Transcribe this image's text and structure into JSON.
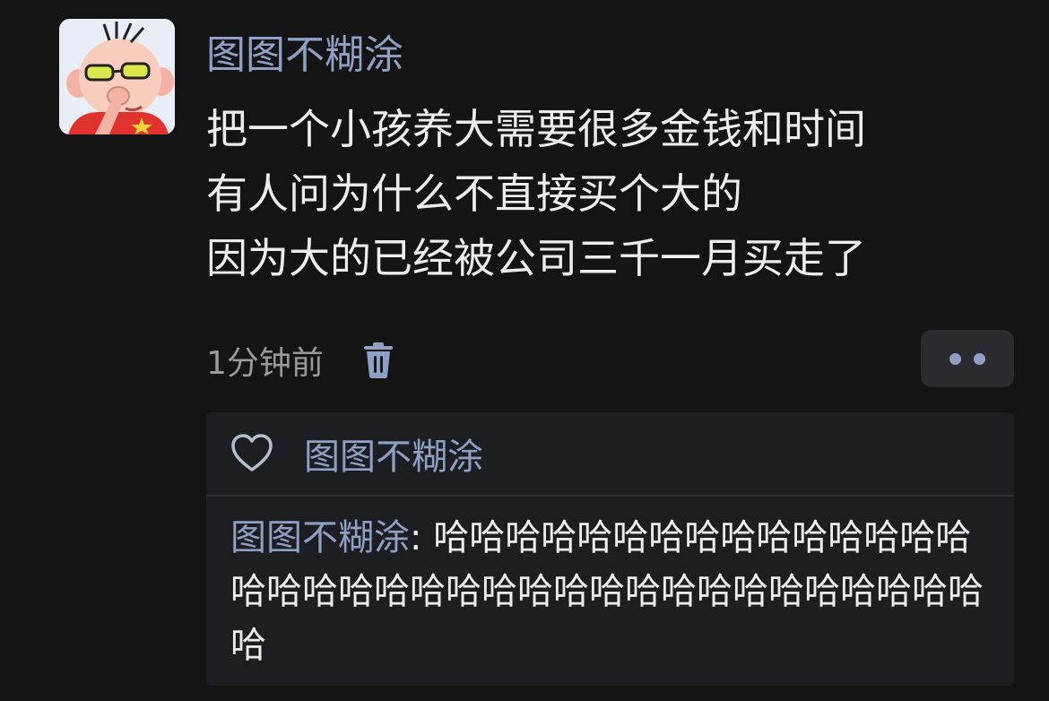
{
  "post": {
    "author": "图图不糊涂",
    "lines": [
      "把一个小孩养大需要很多金钱和时间",
      "有人问为什么不直接买个大的",
      "因为大的已经被公司三千一月买走了"
    ],
    "timestamp": "1分钟前",
    "delete_icon": "trash-icon",
    "more_icon": "ellipsis-icon"
  },
  "likes": {
    "icon": "heart-outline-icon",
    "names": "图图不糊涂"
  },
  "comments": [
    {
      "author": "图图不糊涂",
      "separator": ": ",
      "text": "哈哈哈哈哈哈哈哈哈哈哈哈哈哈哈哈哈哈哈哈哈哈哈哈哈哈哈哈哈哈哈哈哈哈哈哈哈"
    }
  ],
  "colors": {
    "background": "#141414",
    "link_blue": "#8ea0c4",
    "text": "#ededed",
    "muted": "#9a9a9a",
    "card": "#1d1e21"
  }
}
